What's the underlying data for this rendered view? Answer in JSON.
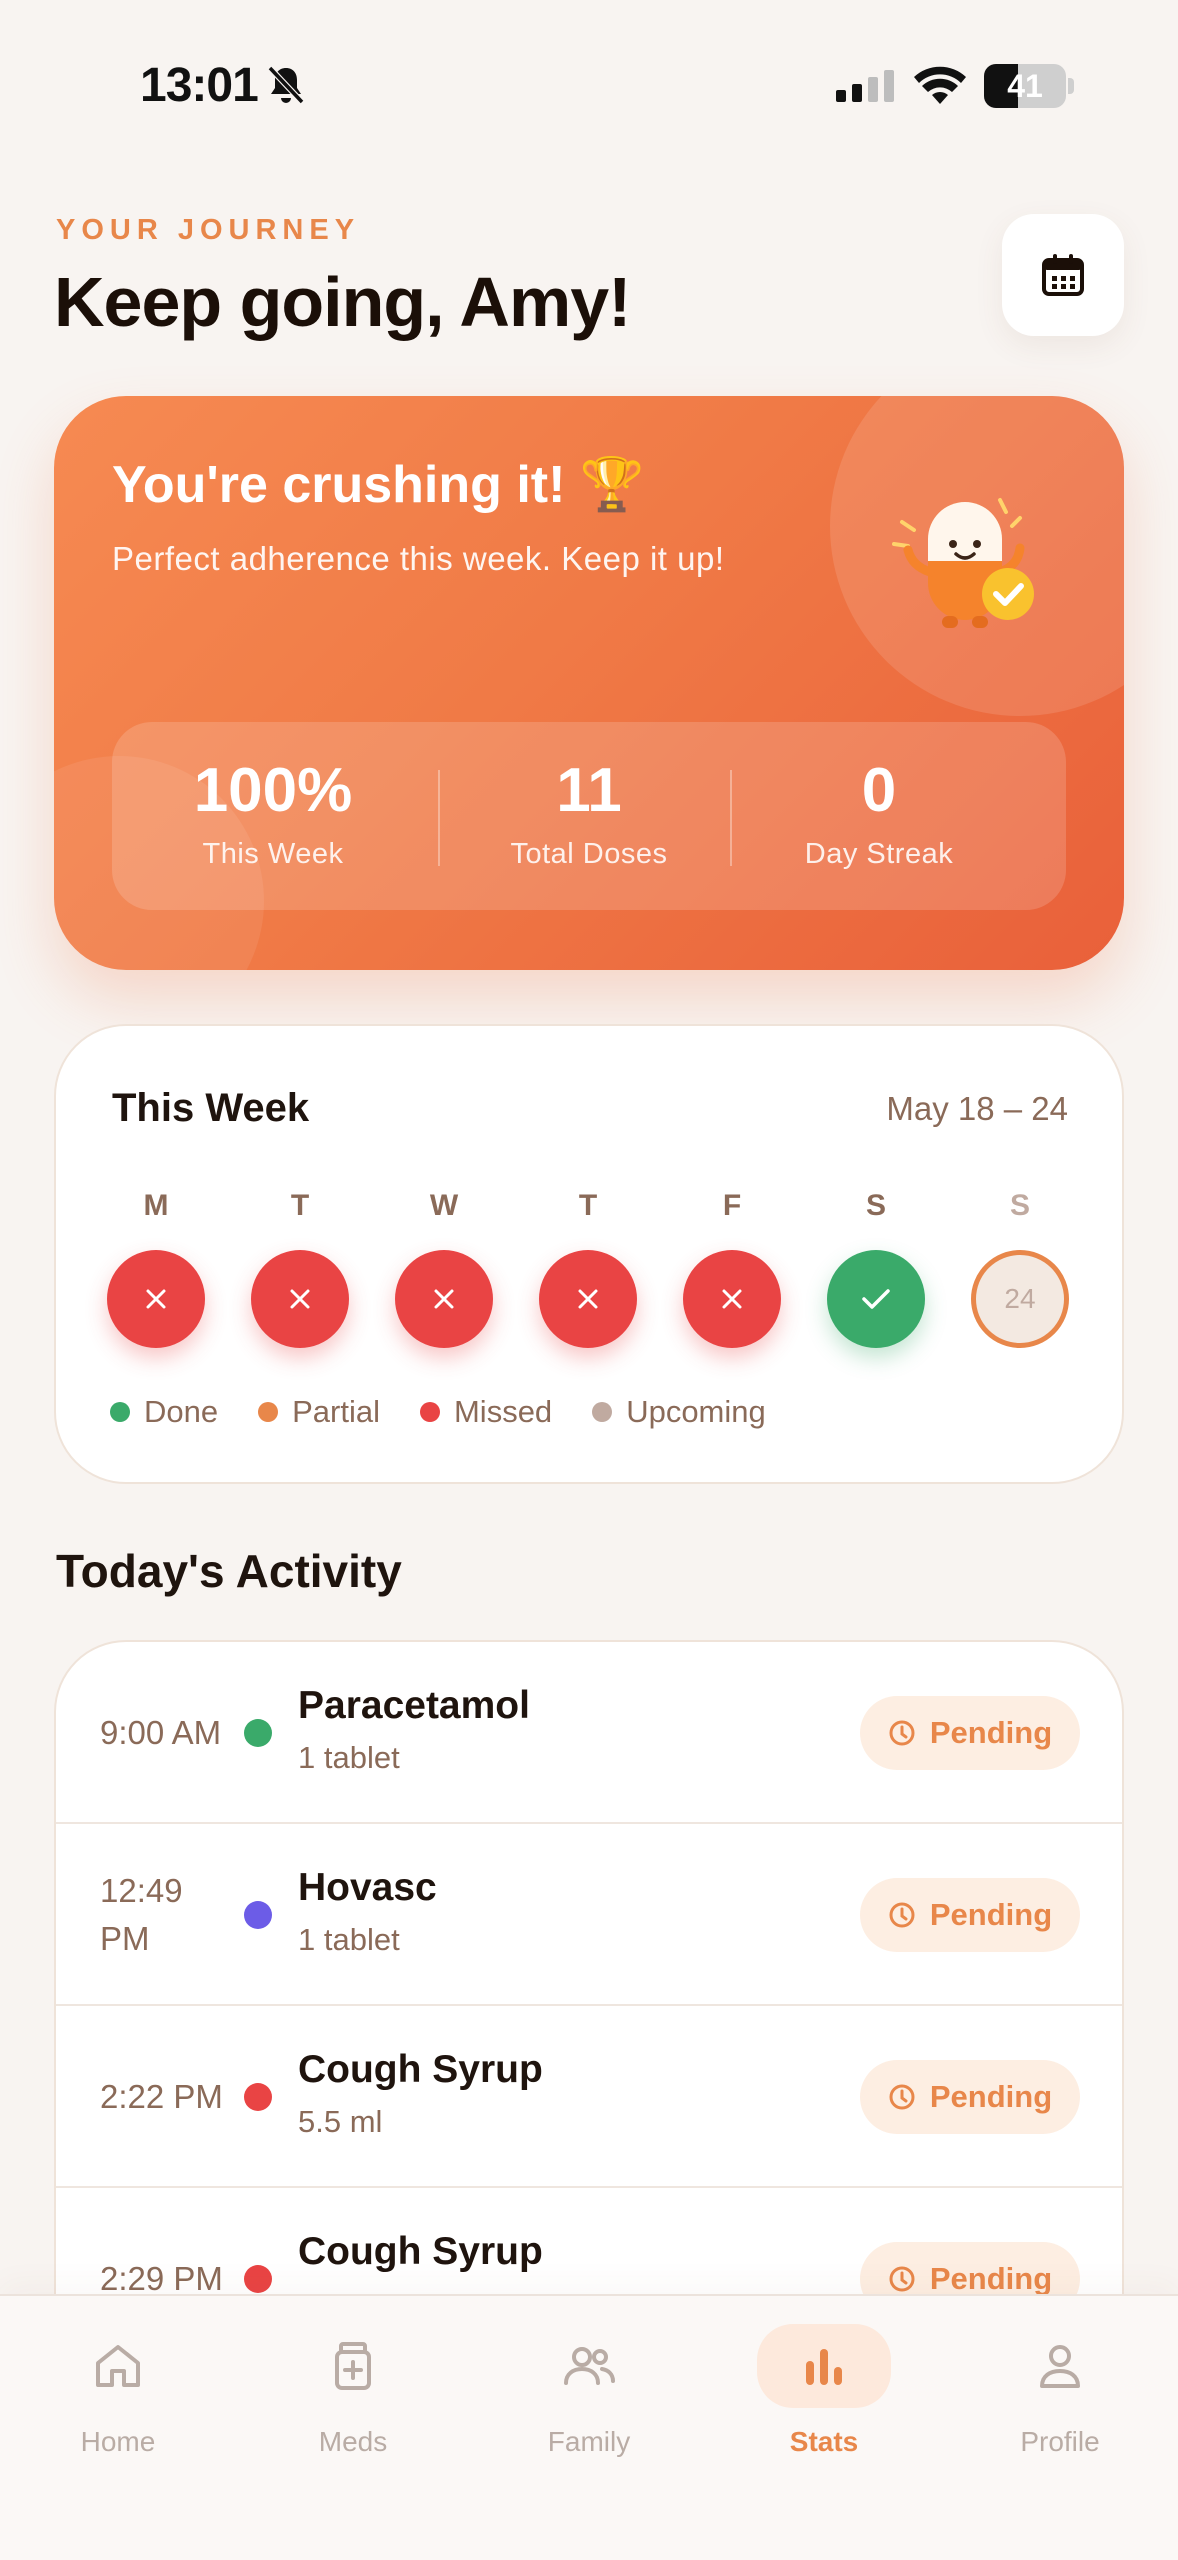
{
  "status_bar": {
    "time": "13:01",
    "battery": "41",
    "battery_level": 0.41,
    "icons": [
      "bell-off-icon",
      "signal-icon",
      "wifi-icon",
      "battery-icon"
    ]
  },
  "header": {
    "eyebrow": "YOUR JOURNEY",
    "greeting": "Keep going, Amy!",
    "calendar_icon": "calendar-icon"
  },
  "hero": {
    "title": "You're crushing it! 🏆",
    "subtitle": "Perfect adherence this week. Keep it up!",
    "stats": [
      {
        "value": "100%",
        "label": "This Week"
      },
      {
        "value": "11",
        "label": "Total Doses"
      },
      {
        "value": "0",
        "label": "Day Streak"
      }
    ]
  },
  "week": {
    "title": "This Week",
    "range": "May 18 – 24",
    "days": [
      {
        "letter": "M",
        "status": "missed",
        "mark": "✕"
      },
      {
        "letter": "T",
        "status": "missed",
        "mark": "✕"
      },
      {
        "letter": "W",
        "status": "missed",
        "mark": "✕"
      },
      {
        "letter": "T",
        "status": "missed",
        "mark": "✕"
      },
      {
        "letter": "F",
        "status": "missed",
        "mark": "✕"
      },
      {
        "letter": "S",
        "status": "done",
        "mark": "✓"
      },
      {
        "letter": "S",
        "status": "upcoming",
        "mark": "24"
      }
    ],
    "legend": [
      {
        "label": "Done",
        "color": "#3aaa6a"
      },
      {
        "label": "Partial",
        "color": "#e8874a"
      },
      {
        "label": "Missed",
        "color": "#e94444"
      },
      {
        "label": "Upcoming",
        "color": "#c0aaa0"
      }
    ]
  },
  "activity": {
    "title": "Today's Activity",
    "items": [
      {
        "time": "9:00 AM",
        "dot_color": "#3aaa6a",
        "name": "Paracetamol",
        "dose": "1 tablet",
        "status": "Pending"
      },
      {
        "time": "12:49 PM",
        "dot_color": "#6c5ce7",
        "name": "Hovasc",
        "dose": "1 tablet",
        "status": "Pending"
      },
      {
        "time": "2:22 PM",
        "dot_color": "#e94444",
        "name": "Cough Syrup",
        "dose": "5.5 ml",
        "status": "Pending"
      },
      {
        "time": "2:29 PM",
        "dot_color": "#e94444",
        "name": "Cough Syrup",
        "dose": "",
        "status": "Pending"
      }
    ]
  },
  "nav": {
    "items": [
      {
        "label": "Home",
        "icon": "home-icon"
      },
      {
        "label": "Meds",
        "icon": "meds-icon"
      },
      {
        "label": "Family",
        "icon": "family-icon"
      },
      {
        "label": "Stats",
        "icon": "stats-icon"
      },
      {
        "label": "Profile",
        "icon": "profile-icon"
      }
    ],
    "active": "Stats"
  },
  "colors": {
    "accent": "#e8874a",
    "background": "#f8f4f1",
    "missed": "#e94444",
    "done": "#3aaa6a"
  }
}
